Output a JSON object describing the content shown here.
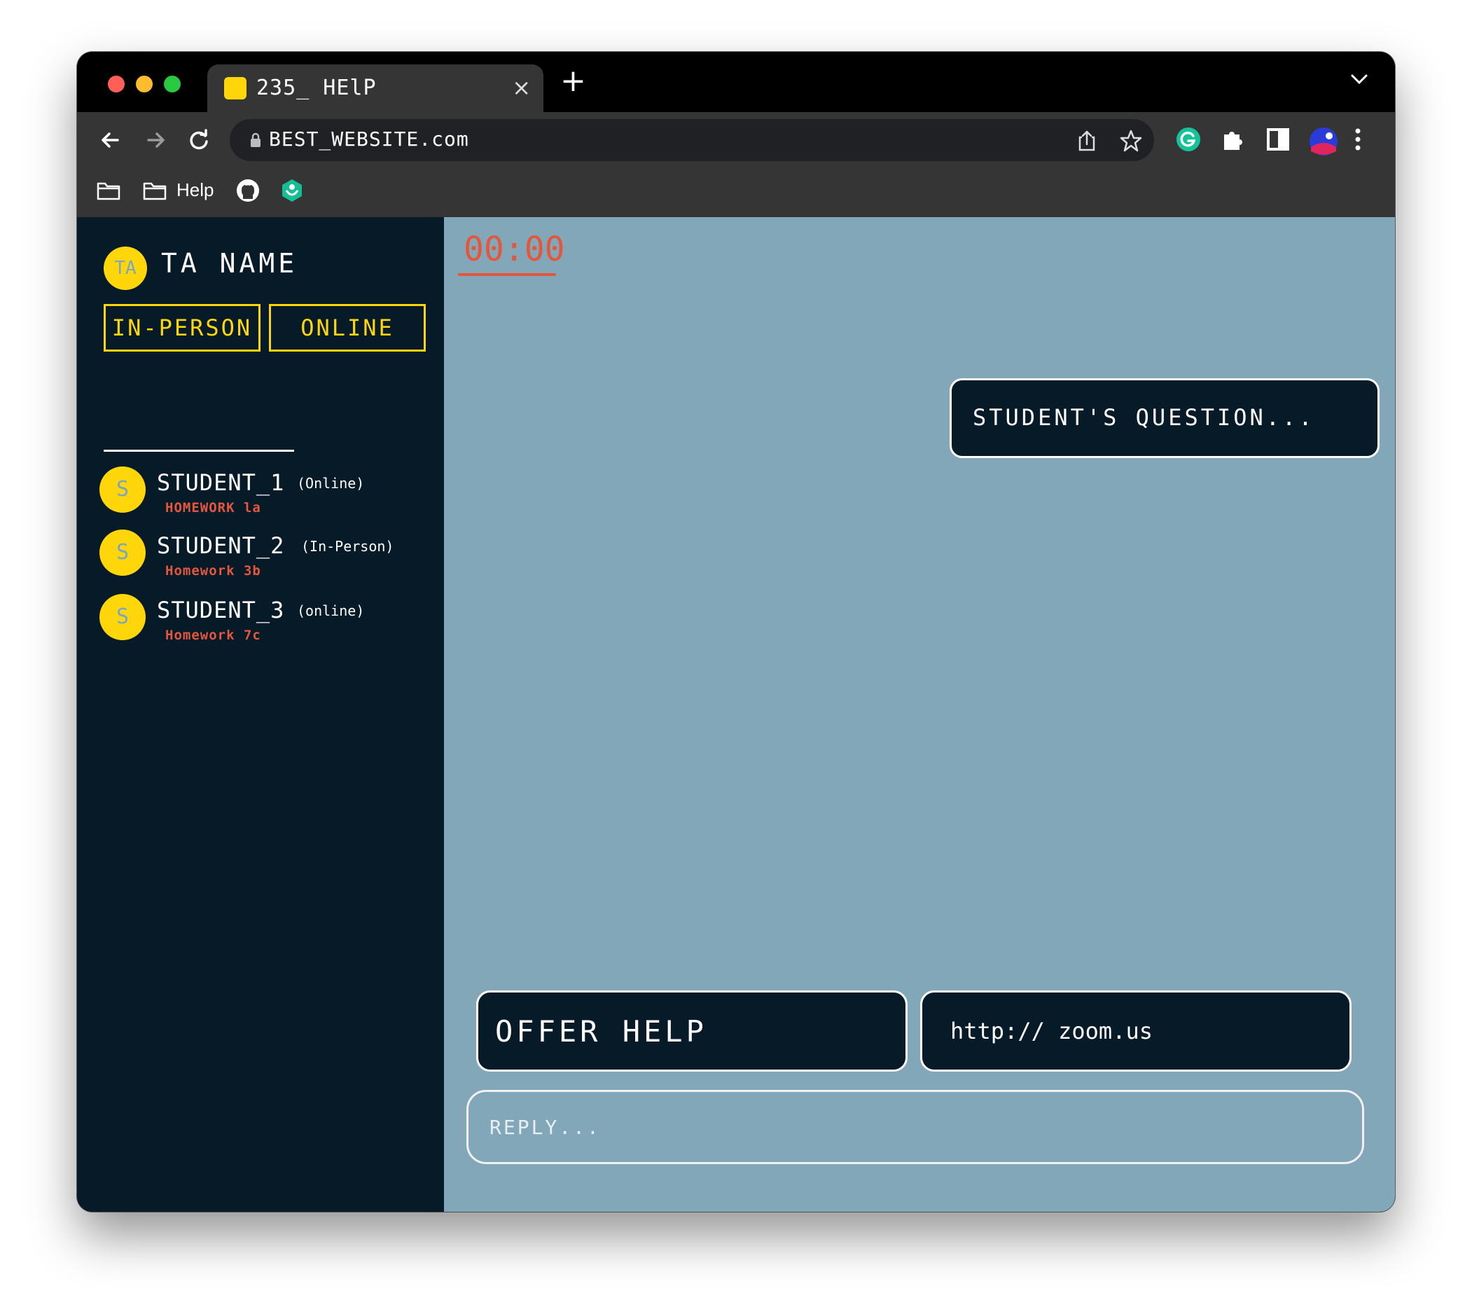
{
  "browser": {
    "tab_title": "235_ HElP",
    "tab_close": "×",
    "new_tab": "+",
    "url": "BEST_WEBSITE.com",
    "bookmarks": {
      "help_label": "Help"
    }
  },
  "sidebar": {
    "ta_initials": "TA",
    "ta_name": "TA NAME",
    "mode_in_person": "IN-PERSON",
    "mode_online": "ONLINE",
    "students": [
      {
        "initial": "S",
        "name": "STUDENT_1",
        "mode": "(Online)",
        "homework": "HOMEWORK la"
      },
      {
        "initial": "S",
        "name": "STUDENT_2",
        "mode": "(In-Person)",
        "homework": "Homework 3b"
      },
      {
        "initial": "S",
        "name": "STUDENT_3",
        "mode": "(online)",
        "homework": "Homework 7c"
      }
    ]
  },
  "main": {
    "timer": "00:00",
    "question": "STUDENT'S QUESTION...",
    "offer_help": "OFFER HELP",
    "zoom_link": "http:// zoom.us",
    "reply_placeholder": "REPLY..."
  },
  "colors": {
    "accent_yellow": "#ffd60a",
    "accent_red": "#e4573d",
    "sidebar_bg": "#061a28",
    "main_bg": "#81a7b9"
  }
}
